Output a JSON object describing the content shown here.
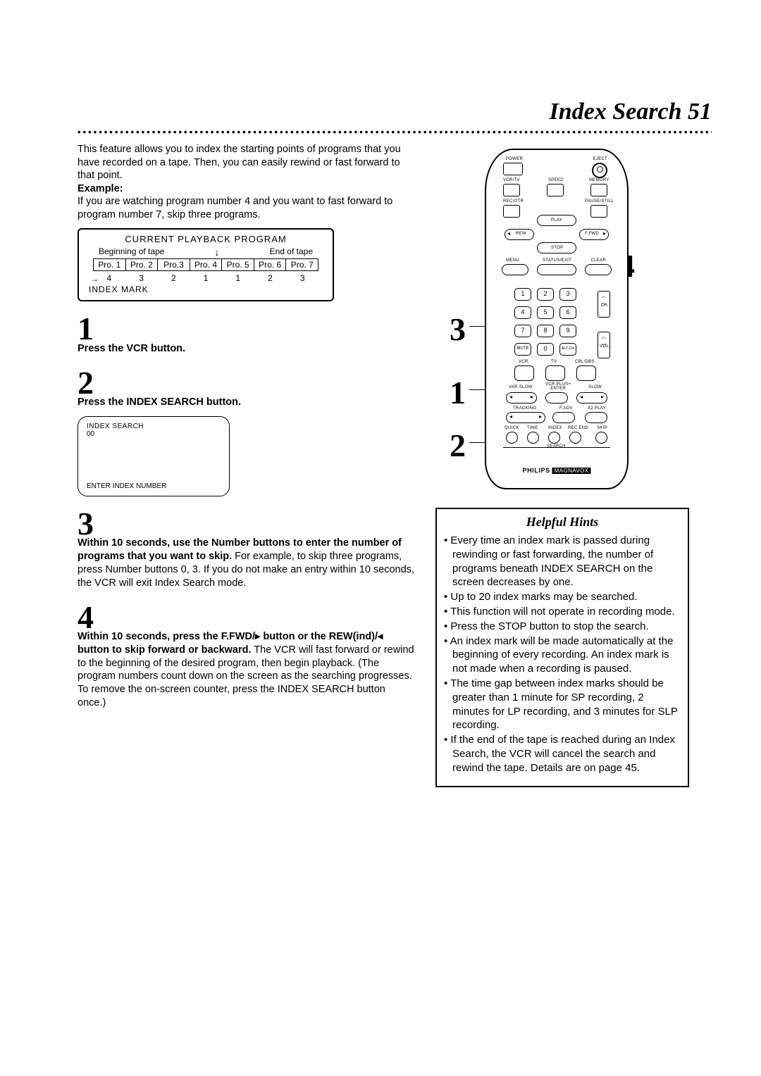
{
  "title": "Index Search 51",
  "intro": "This feature allows you to index the starting points of programs that you have recorded on a tape. Then, you can easily rewind or fast forward to that point.",
  "example_label": "Example:",
  "example_text": "If you are watching program number 4 and you want to fast forward to program number 7, skip three programs.",
  "diagram": {
    "header": "CURRENT PLAYBACK PROGRAM",
    "begin": "Beginning of tape",
    "end": "End of tape",
    "progs": [
      "Pro. 1",
      "Pro. 2",
      "Pro.3",
      "Pro. 4",
      "Pro. 5",
      "Pro. 6",
      "Pro. 7"
    ],
    "counts": [
      "4",
      "3",
      "2",
      "1",
      "1",
      "2",
      "3"
    ],
    "mark": "INDEX MARK"
  },
  "steps": {
    "s1_num": "1",
    "s1_text": "Press the VCR button.",
    "s2_num": "2",
    "s2_text": "Press the INDEX SEARCH button.",
    "osd_line1": "INDEX SEARCH",
    "osd_line2": "00",
    "osd_bottom": "ENTER INDEX NUMBER",
    "s3_num": "3",
    "s3_bold": "Within 10 seconds, use the Number buttons to enter the number of programs that you want to skip.",
    "s3_rest": "  For example, to skip three programs, press Number buttons 0, 3.  If you do not make an entry within 10 seconds, the VCR will exit Index Search mode.",
    "s4_num": "4",
    "s4_bold": "Within 10 seconds, press the F.FWD/▸ button or the REW(ind)/◂ button to skip forward or backward.",
    "s4_rest": "  The VCR will fast forward or rewind to the beginning of the desired program, then begin playback. (The program numbers count down on the screen as the searching progresses. To remove the on-screen counter, press the INDEX SEARCH button once.)"
  },
  "remote": {
    "power": "POWER",
    "eject": "EJECT",
    "vcrtv": "VCR/TV",
    "speed": "SPEED",
    "memory": "MEMORY",
    "recotr": "REC/OTR",
    "pause": "PAUSE/STILL",
    "play": "PLAY",
    "rew": "REW",
    "ffwd": "F.FWD",
    "stop": "STOP",
    "menu": "MENU",
    "status": "STATUS/EXIT",
    "clear": "CLEAR",
    "mute": "MUTE",
    "altch": "ALT.CH",
    "ch": "CH.",
    "vol": "VOL.",
    "vcr": "VCR",
    "tv": "TV",
    "cbldbs": "CBL/DBS",
    "varslow": "VAR.SLOW",
    "vcrplus": "VCR PLUS+\nENTER",
    "slow": "SLOW",
    "tracking": "TRACKING",
    "fadv": "F.ADV",
    "x2": "X2 PLAY",
    "quick": "QUICK",
    "time": "TIME",
    "index": "INDEX",
    "recend": "REC END",
    "skip": "SKIP",
    "search": "SEARCH",
    "brand": "PHILIPS",
    "brand2": "MAGNAVOX",
    "nums": [
      "1",
      "2",
      "3",
      "4",
      "5",
      "6",
      "7",
      "8",
      "9",
      "0"
    ]
  },
  "callouts": {
    "c1": "1",
    "c2": "2",
    "c3": "3",
    "c4": "4"
  },
  "hints": {
    "title": "Helpful Hints",
    "h1": "Every time an index mark is passed during rewinding or fast forwarding, the number of programs beneath INDEX SEARCH on the screen decreases by one.",
    "h2": "Up to 20 index marks may be searched.",
    "h3": "This function will not operate in recording mode.",
    "h4": "Press the STOP button to stop the search.",
    "h5": "An index mark will be made automatically at the beginning of every recording. An index mark is not made when a recording is paused.",
    "h6": "The time gap between index marks should be greater than 1 minute for SP recording, 2 minutes for LP recording, and 3 minutes for SLP recording.",
    "h7": "If the end of the tape is reached during an Index Search, the VCR will cancel the search and rewind the tape. Details are on page 45."
  }
}
